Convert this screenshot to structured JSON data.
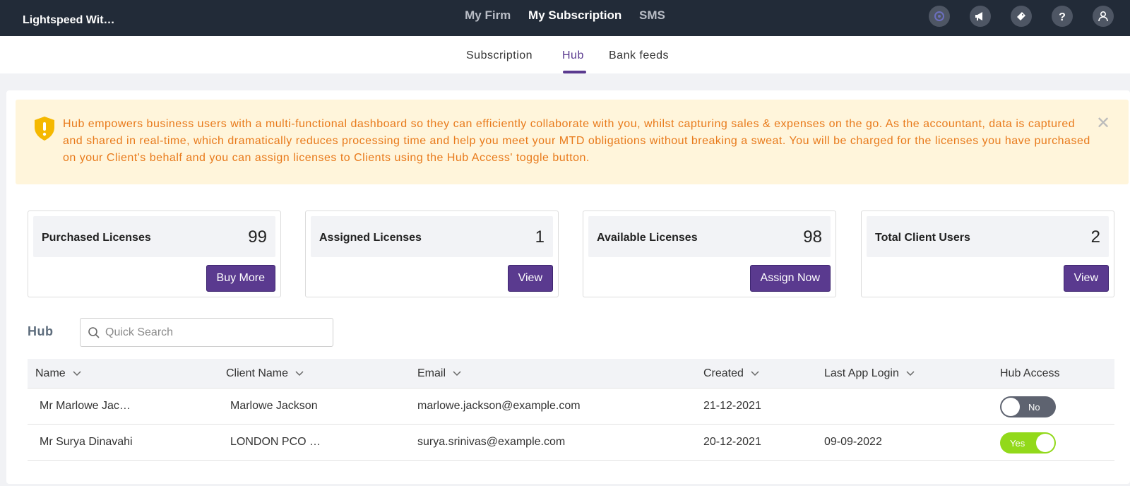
{
  "header": {
    "brand": "Lightspeed Wit…",
    "nav": [
      "My Firm",
      "My Subscription",
      "SMS"
    ],
    "active_nav": "My Subscription",
    "icons": [
      "app-logo-icon",
      "megaphone-icon",
      "ticket-icon",
      "help-icon",
      "user-icon"
    ]
  },
  "subtabs": {
    "items": [
      "Subscription",
      "Hub",
      "Bank feeds"
    ],
    "active": "Hub"
  },
  "banner": {
    "text": "Hub empowers business users with a multi-functional dashboard so they can efficiently collaborate with you, whilst capturing sales & expenses on the go. As the accountant, data is captured and shared in real-time, which dramatically reduces processing time and help you meet your MTD obligations without breaking a sweat. You will be charged for the licenses you have purchased on your Client's behalf and you can assign licenses to Clients using the Hub Access' toggle button.",
    "close": "✕"
  },
  "cards": [
    {
      "title": "Purchased Licenses",
      "value": "99",
      "button": "Buy More"
    },
    {
      "title": "Assigned Licenses",
      "value": "1",
      "button": "View"
    },
    {
      "title": "Available Licenses",
      "value": "98",
      "button": "Assign Now"
    },
    {
      "title": "Total Client Users",
      "value": "2",
      "button": "View"
    }
  ],
  "hub": {
    "title": "Hub",
    "search_placeholder": "Quick Search"
  },
  "table": {
    "columns": [
      "Name",
      "Client Name",
      "Email",
      "Created",
      "Last App Login",
      "Hub Access"
    ],
    "rows": [
      {
        "name": "Mr Marlowe Jac…",
        "client": "Marlowe Jackson",
        "email": "marlowe.jackson@example.com",
        "created": "21-12-2021",
        "last_login": "",
        "hub_access": "No"
      },
      {
        "name": "Mr Surya Dinavahi",
        "client": "LONDON PCO …",
        "email": "surya.srinivas@example.com",
        "created": "20-12-2021",
        "last_login": "09-09-2022",
        "hub_access": "Yes"
      }
    ]
  },
  "colors": {
    "topbar": "#222b38",
    "accent": "#5a3a8f",
    "banner_bg": "#fff5db",
    "banner_text": "#e87a1b",
    "toggle_on": "#92d91a",
    "toggle_off": "#5e6370"
  }
}
